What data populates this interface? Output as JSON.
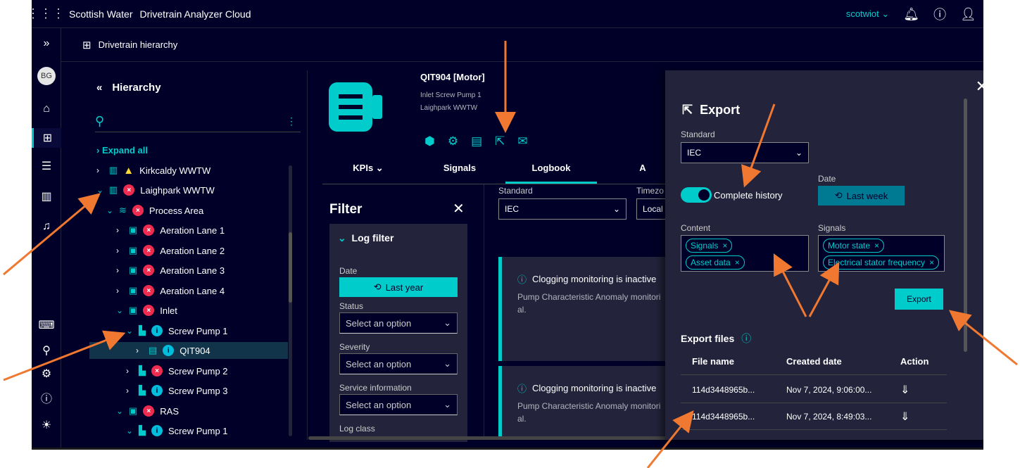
{
  "topbar": {
    "brand": "Scottish Water",
    "app_name": "Drivetrain Analyzer Cloud",
    "user": "scotwiot ⌄"
  },
  "rail": {
    "avatar": "BG"
  },
  "breadcrumb": {
    "label": "Drivetrain hierarchy"
  },
  "hierarchy": {
    "title": "Hierarchy",
    "expand_all": "Expand all",
    "nodes": [
      {
        "label": "Kirkcaldy WWTW"
      },
      {
        "label": "Laighpark WWTW"
      },
      {
        "label": "Process Area"
      },
      {
        "label": "Aeration Lane 1"
      },
      {
        "label": "Aeration Lane 2"
      },
      {
        "label": "Aeration Lane 3"
      },
      {
        "label": "Aeration Lane 4"
      },
      {
        "label": "Inlet"
      },
      {
        "label": "Screw Pump 1"
      },
      {
        "label": "QIT904"
      },
      {
        "label": "Screw Pump 2"
      },
      {
        "label": "Screw Pump 3"
      },
      {
        "label": "RAS"
      },
      {
        "label": "Screw Pump 1"
      }
    ]
  },
  "asset": {
    "name": "QIT904 [Motor]",
    "line1": "Inlet Screw Pump 1",
    "line2": "Laighpark WWTW"
  },
  "tabs": [
    "KPIs ⌄",
    "Signals",
    "Logbook",
    "A"
  ],
  "filter": {
    "title": "Filter",
    "log_filter": "Log filter",
    "date_label": "Date",
    "date_button": "Last year",
    "status_label": "Status",
    "severity_label": "Severity",
    "service_label": "Service information",
    "log_class_label": "Log class",
    "placeholder": "Select an option"
  },
  "middle": {
    "standard_label": "Standard",
    "standard_value": "IEC",
    "timezone_label": "Timezo",
    "timezone_value": "Local"
  },
  "cards": [
    {
      "title": "Clogging monitoring is inactive",
      "line1": "Pump Characteristic Anomaly monitori",
      "line2": "al."
    },
    {
      "title": "Clogging monitoring is inactive",
      "line1": "Pump Characteristic Anomaly monitori",
      "line2": "al."
    }
  ],
  "export": {
    "title": "Export",
    "standard_label": "Standard",
    "standard_value": "IEC",
    "toggle_label": "Complete history",
    "date_label": "Date",
    "date_button": "Last week",
    "content_label": "Content",
    "content_chips": [
      "Signals",
      "Asset data"
    ],
    "signals_label": "Signals",
    "signals_chips": [
      "Motor state",
      "Electrical stator frequency"
    ],
    "export_button": "Export",
    "files_title": "Export files",
    "columns": [
      "File name",
      "Created date",
      "Action"
    ],
    "rows": [
      {
        "file": "114d3448965b...",
        "date": "Nov 7, 2024, 9:06:00..."
      },
      {
        "file": "114d3448965b...",
        "date": "Nov 7, 2024, 8:49:03..."
      }
    ]
  },
  "colors": {
    "background": "#000028",
    "panel": "#23233c",
    "accent": "#00cccc",
    "error": "#ef2b4f",
    "warning": "#ffd732",
    "annotation": "#f07830"
  }
}
